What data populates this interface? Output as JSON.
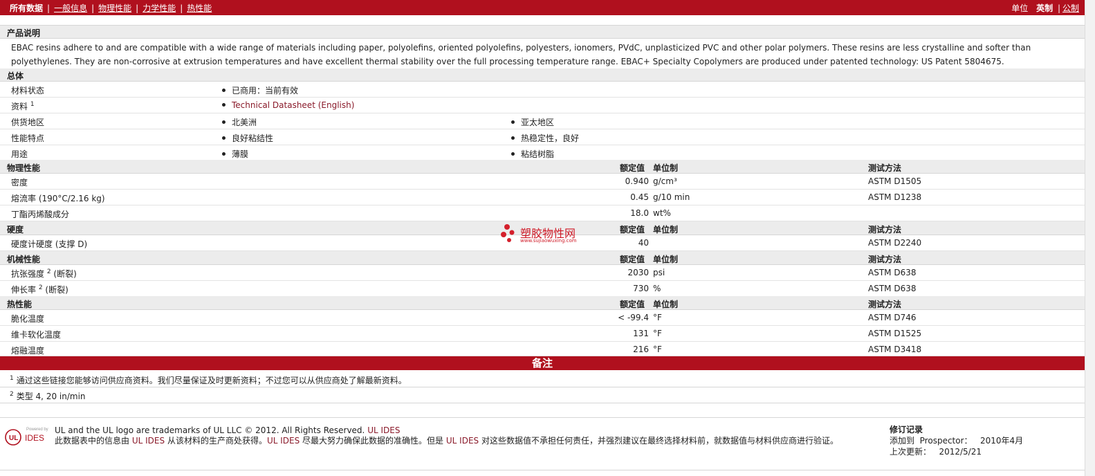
{
  "topbar": {
    "all_data": "所有数据",
    "tabs": [
      "一般信息",
      "物理性能",
      "力学性能",
      "热性能"
    ],
    "units_label": "单位",
    "unit_english": "英制",
    "unit_separator": "|",
    "unit_metric": "公制"
  },
  "product_description": {
    "title": "产品说明",
    "text": "EBAC resins adhere to and are compatible with a wide range of materials including paper, polyolefins, oriented polyolefins, polyesters, ionomers, PVdC, unplasticized PVC and other polar polymers. These resins are less crystalline and softer than polyethylenes. They are non-corrosive at extrusion temperatures and have excellent thermal stability over the full processing temperature range. EBAC+ Specialty Copolymers are produced under patented technology: US Patent 5804675."
  },
  "general": {
    "title": "总体",
    "rows": [
      {
        "label": "材料状态",
        "sup": "",
        "v1": "已商用：当前有效",
        "v2": ""
      },
      {
        "label": "资料",
        "sup": "1",
        "v1": "Technical Datasheet (English)",
        "v2": ""
      },
      {
        "label": "供货地区",
        "sup": "",
        "v1": "北美洲",
        "v2": "亚太地区"
      },
      {
        "label": "性能特点",
        "sup": "",
        "v1": "良好粘结性",
        "v2": "热稳定性，良好"
      },
      {
        "label": "用途",
        "sup": "",
        "v1": "薄膜",
        "v2": "粘结树脂"
      }
    ]
  },
  "column_headers": {
    "nominal": "额定值",
    "unit": "单位制",
    "test": "测试方法"
  },
  "physical": {
    "title": "物理性能",
    "rows": [
      {
        "label": "密度",
        "value": "0.940",
        "unit": "g/cm³",
        "test": "ASTM D1505"
      },
      {
        "label": "熔流率 (190°C/2.16 kg)",
        "value": "0.45",
        "unit": "g/10 min",
        "test": "ASTM D1238"
      },
      {
        "label": "丁酯丙烯酸成分",
        "value": "18.0",
        "unit": "wt%",
        "test": ""
      }
    ]
  },
  "hardness": {
    "title": "硬度",
    "rows": [
      {
        "label": "硬度计硬度 (支撑 D)",
        "value": "40",
        "unit": "",
        "test": "ASTM D2240"
      }
    ]
  },
  "mechanical": {
    "title": "机械性能",
    "rows": [
      {
        "label_a": "抗张强度",
        "sup": "2",
        "label_b": "(断裂)",
        "value": "2030",
        "unit": "psi",
        "test": "ASTM D638"
      },
      {
        "label_a": "伸长率",
        "sup": "2",
        "label_b": "(断裂)",
        "value": "730",
        "unit": "%",
        "test": "ASTM D638"
      }
    ]
  },
  "thermal": {
    "title": "热性能",
    "rows": [
      {
        "label": "脆化温度",
        "value": "< -99.4",
        "unit": "°F",
        "test": "ASTM D746"
      },
      {
        "label": "维卡软化温度",
        "value": "131",
        "unit": "°F",
        "test": "ASTM D1525"
      },
      {
        "label": "熔融温度",
        "value": "216",
        "unit": "°F",
        "test": "ASTM D3418"
      }
    ]
  },
  "notes": {
    "title": "备注",
    "items": [
      {
        "num": "1",
        "text": "通过这些链接您能够访问供应商资料。我们尽量保证及时更新资料；不过您可以从供应商处了解最新资料。"
      },
      {
        "num": "2",
        "text": "类型  4, 20 in/min"
      }
    ]
  },
  "watermark": {
    "name": "塑胶物性网",
    "url": "www.sujiaowuxing.com"
  },
  "footer": {
    "logo_powered": "Powered by",
    "logo_ul": "UL",
    "logo_ides": "IDES",
    "trademark": "UL and the UL logo are trademarks of UL LLC © 2012. All Rights Reserved.",
    "trademark_link": "UL IDES",
    "disclaimer_a": "此数据表中的信息由",
    "disclaimer_link1": "UL IDES",
    "disclaimer_b": "从该材料的生产商处获得。",
    "disclaimer_link2": "UL IDES",
    "disclaimer_c": "尽最大努力确保此数据的准确性。但是",
    "disclaimer_link3": "UL IDES",
    "disclaimer_d": "对这些数据值不承担任何责任，并强烈建议在最终选择材料前，就数据值与材料供应商进行验证。",
    "revision_title": "修订记录",
    "added_label": "添加到",
    "added_prospector": "Prospector：",
    "added_date": "2010年4月",
    "updated_label": "上次更新：",
    "updated_date": "2012/5/21"
  }
}
